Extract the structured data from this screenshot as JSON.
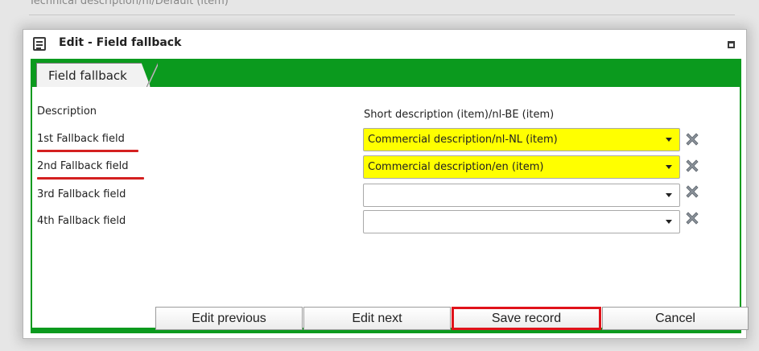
{
  "background": {
    "breadcrumb": "Technical description/nl/Default (item)"
  },
  "dialog": {
    "title": "Edit - Field fallback",
    "icons": {
      "title": "form-icon",
      "maximize": "maximize-icon"
    }
  },
  "tab": {
    "label": "Field fallback"
  },
  "form": {
    "description_label": "Description",
    "description_value": "Short description (item)/nl-BE (item)",
    "fields": [
      {
        "label": "1st Fallback field",
        "value": "Commercial description/nl-NL (item)",
        "highlighted": true,
        "underlined": true
      },
      {
        "label": "2nd Fallback field",
        "value": "Commercial description/en (item)",
        "highlighted": true,
        "underlined": true
      },
      {
        "label": "3rd Fallback field",
        "value": "",
        "highlighted": false,
        "underlined": false
      },
      {
        "label": "4th Fallback field",
        "value": "",
        "highlighted": false,
        "underlined": false
      }
    ],
    "clear_icon": "delete-x-icon"
  },
  "buttons": {
    "edit_previous": "Edit previous",
    "edit_next": "Edit next",
    "save_record": "Save record",
    "cancel": "Cancel"
  },
  "colors": {
    "frame_green": "#0b9a1e",
    "highlight_yellow": "#ffff00",
    "annotation_red": "#d42020"
  }
}
